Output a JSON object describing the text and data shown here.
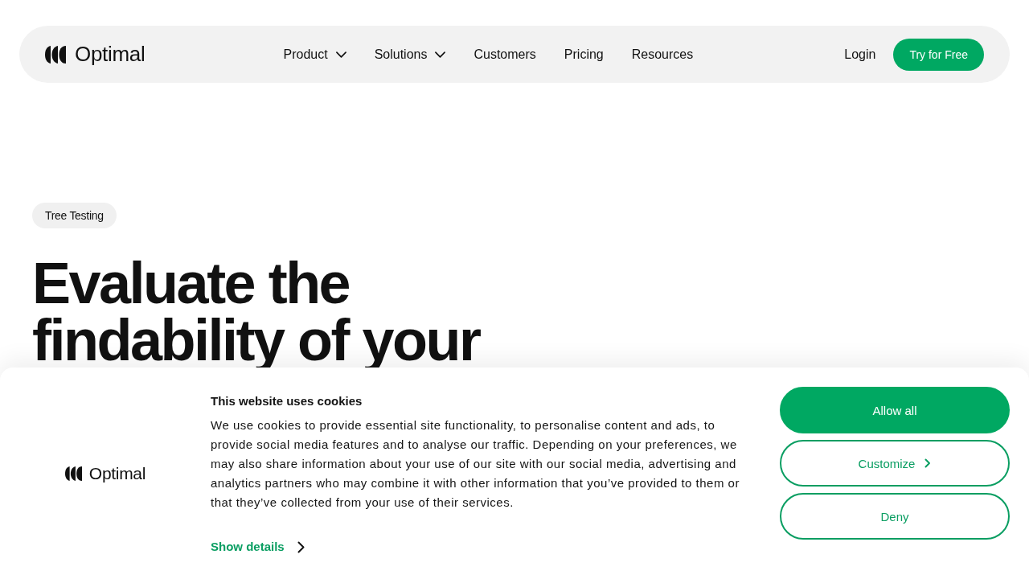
{
  "nav": {
    "brand": "Optimal",
    "links": [
      {
        "label": "Product",
        "dropdown": true
      },
      {
        "label": "Solutions",
        "dropdown": true
      },
      {
        "label": "Customers",
        "dropdown": false
      },
      {
        "label": "Pricing",
        "dropdown": false
      },
      {
        "label": "Resources",
        "dropdown": false
      }
    ],
    "login": "Login",
    "cta": "Try for Free"
  },
  "hero": {
    "tag": "Tree Testing",
    "heading_lines": [
      "Evaluate the",
      "findability of your"
    ]
  },
  "cookie_banner": {
    "brand": "Optimal",
    "title": "This website uses cookies",
    "body": "We use cookies to provide essential site functionality, to personalise content and ads, to provide social media features and to analyse our traffic. Depending on your preferences, we may also share information about your use of our site with our social media, advertising and analytics partners who may combine it with other information that you’ve provided to them or that they’ve collected from your use of their services.",
    "details_link": "Show details",
    "buttons": [
      {
        "label": "Allow all",
        "kind": "filled",
        "chevron": false
      },
      {
        "label": "Customize",
        "kind": "outline",
        "chevron": true
      },
      {
        "label": "Deny",
        "kind": "outline",
        "chevron": false
      }
    ]
  }
}
